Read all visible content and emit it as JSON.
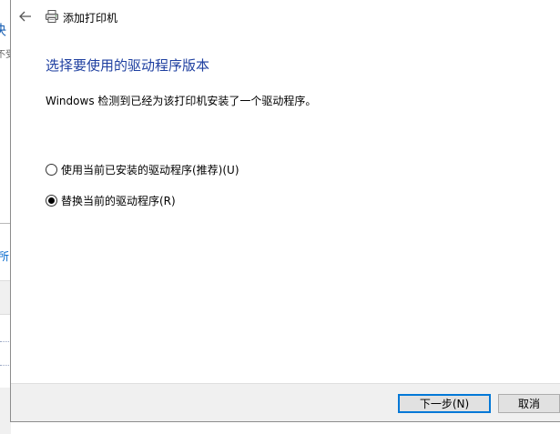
{
  "background_window": {
    "title_fragment": "决",
    "subtitle_fragment": "不受",
    "link_fragment": "所"
  },
  "dialog": {
    "window_title": "添加打印机",
    "heading": "选择要使用的驱动程序版本",
    "description": "Windows 检测到已经为该打印机安装了一个驱动程序。",
    "options": [
      {
        "label": "使用当前已安装的驱动程序(推荐)(U)",
        "selected": false
      },
      {
        "label": "替换当前的驱动程序(R)",
        "selected": true
      }
    ],
    "buttons": {
      "next": "下一步(N)",
      "cancel": "取消"
    }
  },
  "icons": {
    "back": "arrow-left-icon",
    "printer": "printer-icon"
  },
  "colors": {
    "heading": "#1e3fa0",
    "focus_border": "#0078d7",
    "footer_bg": "#f0f0f0"
  }
}
